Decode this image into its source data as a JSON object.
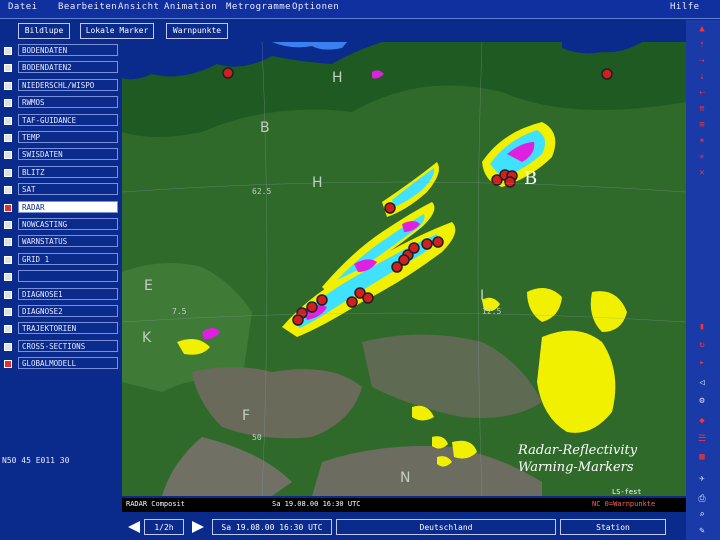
{
  "menubar": {
    "items": [
      "Datei",
      "Bearbeiten",
      "Ansicht",
      "Animation",
      "Metrogramme",
      "Optionen"
    ],
    "help": "Hilfe"
  },
  "tabs": [
    "Bildlupe",
    "Lokale Marker",
    "Warnpunkte"
  ],
  "layers": [
    {
      "label": "BODENDATEN",
      "checked": false,
      "active": false
    },
    {
      "label": "BODENDATEN2",
      "checked": false,
      "active": false
    },
    {
      "label": "NIEDERSCHL/WISPO",
      "checked": false,
      "active": false
    },
    {
      "label": "RWMOS",
      "checked": false,
      "active": false
    },
    {
      "label": "TAF-GUIDANCE",
      "checked": false,
      "active": false
    },
    {
      "label": "TEMP",
      "checked": false,
      "active": false
    },
    {
      "label": "SWISDATEN",
      "checked": false,
      "active": false
    },
    {
      "label": "BLITZ",
      "checked": false,
      "active": false
    },
    {
      "label": "SAT",
      "checked": false,
      "active": false
    },
    {
      "label": "RADAR",
      "checked": true,
      "active": true
    },
    {
      "label": "NOWCASTING",
      "checked": false,
      "active": false
    },
    {
      "label": "WARNSTATUS",
      "checked": false,
      "active": false
    },
    {
      "label": "GRID 1",
      "checked": false,
      "active": false
    },
    {
      "label": "",
      "checked": false,
      "active": false
    },
    {
      "label": "DIAGNOSE1",
      "checked": false,
      "active": false
    },
    {
      "label": "DIAGNOSE2",
      "checked": false,
      "active": false
    },
    {
      "label": "TRAJEKTORIEN",
      "checked": false,
      "active": false
    },
    {
      "label": "CROSS-SECTIONS",
      "checked": false,
      "active": false
    },
    {
      "label": "GLOBALMODELL",
      "checked": true,
      "active": false
    }
  ],
  "coords": "N50 45 E011 30",
  "map": {
    "pressure_labels": [
      "H",
      "B",
      "H",
      "B",
      "E",
      "K",
      "L",
      "F",
      "N"
    ],
    "contour_labels": [
      "62.5",
      "7.5",
      "12.5",
      "50"
    ],
    "caption_line1": "Radar-Reflectivity",
    "caption_line2": "Warning-Markers"
  },
  "statusbar": {
    "left": "RADAR Composit",
    "mid": "Sa 19.08.00 16:30 UTC",
    "right_top": "LS-fest",
    "right_bottom": "NC 0=Warnpunkte"
  },
  "bottombar": {
    "frame": "1/2h",
    "datetime": "Sa 19.08.00 16:30 UTC",
    "region": "Deutschland",
    "station": "Station"
  },
  "colors": {
    "chrome": "#0a2a8c",
    "map_land": "#2f6a2a",
    "radar_yellow": "#f0f000",
    "radar_cyan": "#40e0ff",
    "radar_magenta": "#e020e0",
    "marker_red": "#d02020"
  }
}
